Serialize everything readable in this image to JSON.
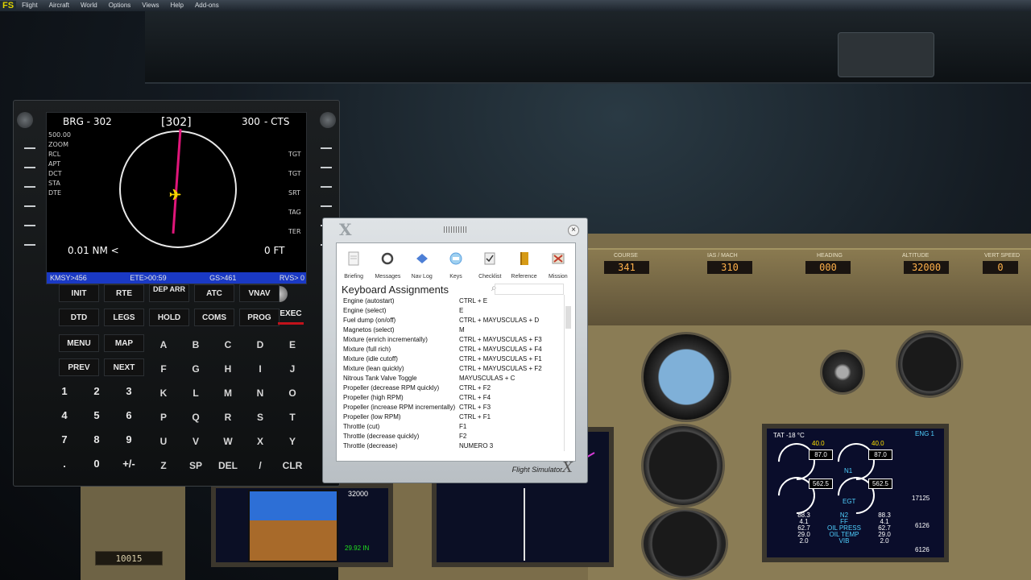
{
  "menu": {
    "logo": "FS",
    "items": [
      "Flight",
      "Aircraft",
      "World",
      "Options",
      "Views",
      "Help",
      "Add-ons"
    ]
  },
  "cdu": {
    "screen": {
      "brg": "BRG - 302",
      "hdg": "[302]",
      "cts": "300",
      "cts_suffix": "- CTS",
      "range": "0.01 NM <",
      "alt": "0 FT",
      "zoom": "ZOOM",
      "side_labels_left": [
        "500.00",
        "ZOOM",
        "RCL",
        "APT",
        "DCT",
        "STA",
        "DTE"
      ],
      "side_labels_right": [
        "TGT",
        "TGT",
        "SRT",
        "TAG",
        "TER"
      ],
      "status": {
        "left": "KMSY>456",
        "mid": "ETE>00:59",
        "gs": "GS>461",
        "right": "RVS> 0"
      }
    },
    "function_keys": [
      [
        "INIT",
        "RTE",
        "DEP ARR",
        "ATC",
        "VNAV"
      ],
      [
        "DTD",
        "LEGS",
        "HOLD",
        "COMS",
        "PROG"
      ],
      [
        "MENU",
        "MAP"
      ],
      [
        "PREV",
        "NEXT"
      ]
    ],
    "exec_label": "EXEC",
    "alpha_keys": [
      "A",
      "B",
      "C",
      "D",
      "E",
      "F",
      "G",
      "H",
      "I",
      "J",
      "K",
      "L",
      "M",
      "N",
      "O",
      "P",
      "Q",
      "R",
      "S",
      "T",
      "U",
      "V",
      "W",
      "X",
      "Y",
      "Z",
      "SP",
      "DEL",
      "/",
      "CLR"
    ],
    "num_keys": [
      "1",
      "2",
      "3",
      "4",
      "5",
      "6",
      "7",
      "8",
      "9",
      ".",
      "0",
      "+/-"
    ]
  },
  "dialog": {
    "title": "Keyboard Assignments",
    "close_label": "×",
    "brand": "Flight Simulator",
    "tabs": [
      {
        "label": "Briefing",
        "icon": "briefing-icon",
        "color": "#e8e8e8"
      },
      {
        "label": "Messages",
        "icon": "messages-icon",
        "color": "#4a4a4a"
      },
      {
        "label": "Nav Log",
        "icon": "navlog-icon",
        "color": "#4d7fd6"
      },
      {
        "label": "Keys",
        "icon": "keys-icon",
        "color": "#5aa0e0"
      },
      {
        "label": "Checklist",
        "icon": "checklist-icon",
        "color": "#9aa0a4"
      },
      {
        "label": "Reference",
        "icon": "reference-icon",
        "color": "#d69b16"
      },
      {
        "label": "Mission",
        "icon": "mission-icon",
        "color": "#c23b2b"
      }
    ],
    "rows": [
      {
        "action": "Engine (autostart)",
        "key": "CTRL + E"
      },
      {
        "action": "Engine (select)",
        "key": "E"
      },
      {
        "action": "Fuel dump (on/off)",
        "key": "CTRL + MAYUSCULAS + D"
      },
      {
        "action": "Magnetos (select)",
        "key": "M"
      },
      {
        "action": "Mixture (enrich incrementally)",
        "key": "CTRL + MAYUSCULAS + F3"
      },
      {
        "action": "Mixture (full rich)",
        "key": "CTRL + MAYUSCULAS + F4"
      },
      {
        "action": "Mixture (idle cutoff)",
        "key": "CTRL + MAYUSCULAS + F1"
      },
      {
        "action": "Mixture (lean quickly)",
        "key": "CTRL + MAYUSCULAS + F2"
      },
      {
        "action": "Nitrous Tank Valve Toggle",
        "key": "MAYUSCULAS + C"
      },
      {
        "action": "Propeller (decrease RPM quickly)",
        "key": "CTRL + F2"
      },
      {
        "action": "Propeller (high RPM)",
        "key": "CTRL + F4"
      },
      {
        "action": "Propeller (increase RPM incrementally)",
        "key": "CTRL + F3"
      },
      {
        "action": "Propeller (low RPM)",
        "key": "CTRL + F1"
      },
      {
        "action": "Throttle (cut)",
        "key": "F1"
      },
      {
        "action": "Throttle (decrease quickly)",
        "key": "F2"
      },
      {
        "action": "Throttle (decrease)",
        "key": "NUMERO 3"
      }
    ]
  },
  "mcp": {
    "labels": [
      "COURSE",
      "IAS / MACH",
      "HEADING",
      "ALTITUDE",
      "VERT SPEED"
    ],
    "values": [
      "341",
      "310",
      "000",
      "32000",
      "0"
    ]
  },
  "eicas": {
    "tat": "TAT -18 °C",
    "eng1": "ENG 1",
    "n1_top": [
      "40.0",
      "40.0"
    ],
    "n1_vals": [
      "87.0",
      "87.0"
    ],
    "egt_vals": [
      "562.5",
      "562.5"
    ],
    "egt": "EGT",
    "n1": "N1",
    "n2_label": "N2",
    "ff_label": "FF",
    "oil_press": "OIL PRESS",
    "oil_temp": "OIL TEMP",
    "vib": "VIB",
    "left_vals": [
      "88.3",
      "4.1",
      "62.7",
      "29.0",
      "2.0"
    ],
    "right_vals": [
      "88.3",
      "4.1",
      "62.7",
      "29.0",
      "2.0"
    ],
    "fuel": "17125",
    "fuel2": "6126",
    "fuel3": "6126"
  },
  "pfd": {
    "alt": "32000",
    "baro": "29.92 IN"
  },
  "bottom_readout": "10015"
}
